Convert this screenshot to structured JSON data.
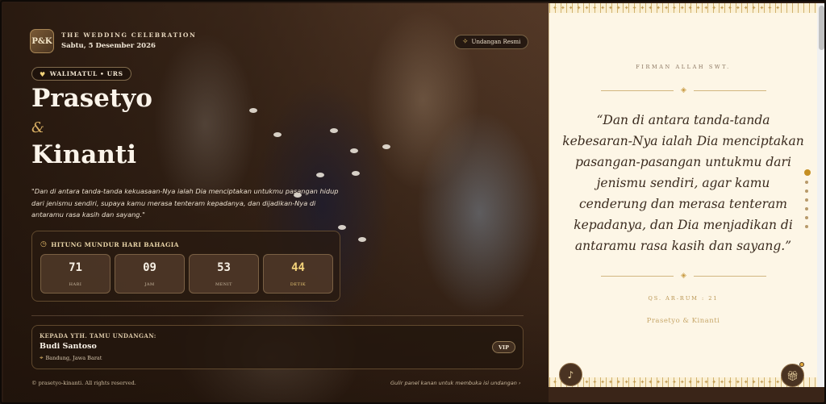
{
  "hero": {
    "logo": "P&K",
    "tagline": "THE WEDDING CELEBRATION",
    "date": "Sabtu, 5 Desember 2026",
    "invite_button": "Undangan Resmi",
    "badge": "WALIMATUL • URS",
    "groom": "Prasetyo",
    "ampersand": "&",
    "bride": "Kinanti",
    "quote": "\"Dan di antara tanda-tanda kekuasaan-Nya ialah Dia menciptakan untukmu pasangan hidup dari jenismu sendiri, supaya kamu merasa tenteram kepadanya, dan dijadikan-Nya di antaramu rasa kasih dan sayang.\""
  },
  "countdown": {
    "title": "HITUNG MUNDUR HARI BAHAGIA",
    "days": "71",
    "days_label": "HARI",
    "hours": "09",
    "hours_label": "JAM",
    "minutes": "53",
    "minutes_label": "MENIT",
    "seconds": "44",
    "seconds_label": "DETIK"
  },
  "guest": {
    "heading": "KEPADA YTH. TAMU UNDANGAN:",
    "name": "Budi Santoso",
    "location": "Bandung, Jawa Barat",
    "tier": "VIP"
  },
  "footer": {
    "copyright": "© prasetyo-kinanti. All rights reserved.",
    "hint": "Gulir panel kanan untuk membuka isi undangan ›"
  },
  "panel": {
    "label": "FIRMAN ALLAH SWT.",
    "quote": "“Dan di antara tanda-tanda kebesaran-Nya ialah Dia menciptakan pasangan-pasangan untukmu dari jenismu sendiri, agar kamu cenderung dan merasa tenteram kepadanya, dan Dia menjadikan di antaramu rasa kasih dan sayang.”",
    "reference": "QS. AR-RUM : 21",
    "signature": "Prasetyo & Kinanti"
  },
  "icons": {
    "invite": "sparkle-icon",
    "badge": "heart-icon",
    "countdown": "clock-icon",
    "location": "pin-icon",
    "music": "music-note-icon",
    "gift": "gift-icon"
  },
  "colors": {
    "accent_gold": "#d7ae63",
    "panel_bg": "#fdf6e6",
    "dark_brown": "#2a1b12"
  }
}
